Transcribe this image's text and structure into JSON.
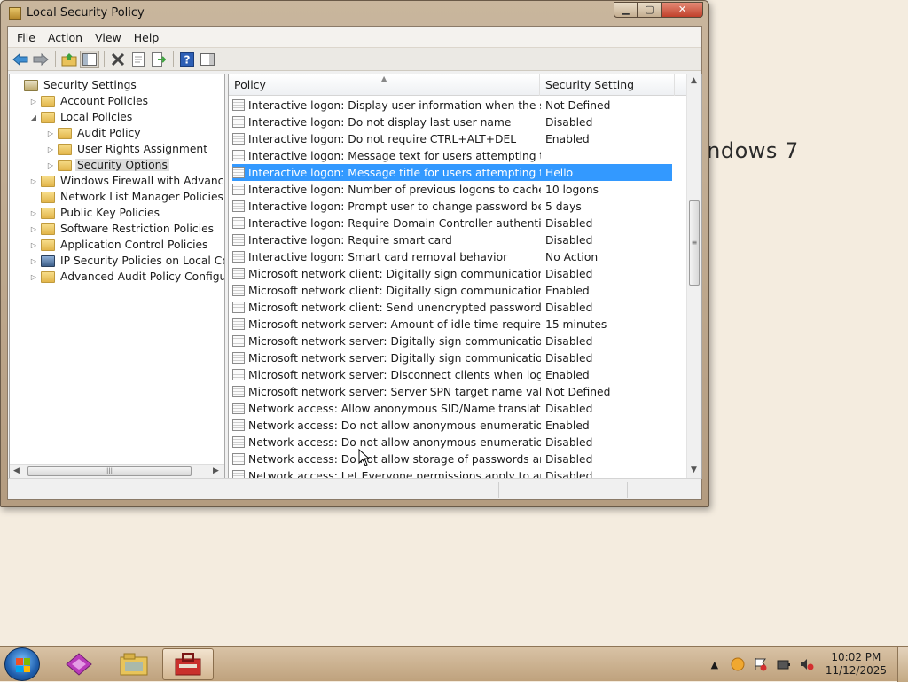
{
  "desktop": {
    "watermark": "indows 7"
  },
  "window": {
    "title": "Local Security Policy",
    "buttons": {
      "minimize": "▁",
      "maximize": "▢",
      "close": "✕"
    }
  },
  "menu": [
    "File",
    "Action",
    "View",
    "Help"
  ],
  "toolbar": {
    "icons": [
      "back-arrow-icon",
      "forward-arrow-icon",
      "up-folder-icon",
      "show-hide-tree-icon",
      "delete-icon",
      "properties-icon",
      "export-list-icon",
      "help-icon",
      "show-hide-action-pane-icon"
    ]
  },
  "tree": {
    "items": [
      {
        "label": "Security Settings",
        "level": 0,
        "arrow": "",
        "icon": "security-settings-icon"
      },
      {
        "label": "Account Policies",
        "level": 1,
        "arrow": "▷",
        "icon": "folder-icon"
      },
      {
        "label": "Local Policies",
        "level": 1,
        "arrow": "◢",
        "icon": "folder-icon"
      },
      {
        "label": "Audit Policy",
        "level": 2,
        "arrow": "▷",
        "icon": "folder-icon"
      },
      {
        "label": "User Rights Assignment",
        "level": 2,
        "arrow": "▷",
        "icon": "folder-icon"
      },
      {
        "label": "Security Options",
        "level": 2,
        "arrow": "▷",
        "icon": "folder-icon",
        "selected": true
      },
      {
        "label": "Windows Firewall with Advanced Secu",
        "level": 1,
        "arrow": "▷",
        "icon": "folder-icon"
      },
      {
        "label": "Network List Manager Policies",
        "level": 1,
        "arrow": "",
        "icon": "folder-icon"
      },
      {
        "label": "Public Key Policies",
        "level": 1,
        "arrow": "▷",
        "icon": "folder-icon"
      },
      {
        "label": "Software Restriction Policies",
        "level": 1,
        "arrow": "▷",
        "icon": "folder-icon"
      },
      {
        "label": "Application Control Policies",
        "level": 1,
        "arrow": "▷",
        "icon": "folder-icon"
      },
      {
        "label": "IP Security Policies on Local Compute",
        "level": 1,
        "arrow": "▷",
        "icon": "ip-security-icon"
      },
      {
        "label": "Advanced Audit Policy Configuration",
        "level": 1,
        "arrow": "▷",
        "icon": "folder-icon"
      }
    ]
  },
  "list": {
    "columns": {
      "policy": "Policy",
      "setting": "Security Setting"
    },
    "rows": [
      {
        "policy": "Interactive logon: Display user information when the session...",
        "setting": "Not Defined"
      },
      {
        "policy": "Interactive logon: Do not display last user name",
        "setting": "Disabled"
      },
      {
        "policy": "Interactive logon: Do not require CTRL+ALT+DEL",
        "setting": "Enabled"
      },
      {
        "policy": "Interactive logon: Message text for users attempting to log on",
        "setting": ""
      },
      {
        "policy": "Interactive logon: Message title for users attempting to log on",
        "setting": "Hello",
        "selected": true
      },
      {
        "policy": "Interactive logon: Number of previous logons to cache (in c...",
        "setting": "10 logons"
      },
      {
        "policy": "Interactive logon: Prompt user to change password before e...",
        "setting": "5 days"
      },
      {
        "policy": "Interactive logon: Require Domain Controller authentication...",
        "setting": "Disabled"
      },
      {
        "policy": "Interactive logon: Require smart card",
        "setting": "Disabled"
      },
      {
        "policy": "Interactive logon: Smart card removal behavior",
        "setting": "No Action"
      },
      {
        "policy": "Microsoft network client: Digitally sign communications (al...",
        "setting": "Disabled"
      },
      {
        "policy": "Microsoft network client: Digitally sign communications (if ...",
        "setting": "Enabled"
      },
      {
        "policy": "Microsoft network client: Send unencrypted password to thi...",
        "setting": "Disabled"
      },
      {
        "policy": "Microsoft network server: Amount of idle time required bef...",
        "setting": "15 minutes"
      },
      {
        "policy": "Microsoft network server: Digitally sign communications (al...",
        "setting": "Disabled"
      },
      {
        "policy": "Microsoft network server: Digitally sign communications (if ...",
        "setting": "Disabled"
      },
      {
        "policy": "Microsoft network server: Disconnect clients when logon ho...",
        "setting": "Enabled"
      },
      {
        "policy": "Microsoft network server: Server SPN target name validation...",
        "setting": "Not Defined"
      },
      {
        "policy": "Network access: Allow anonymous SID/Name translation",
        "setting": "Disabled"
      },
      {
        "policy": "Network access: Do not allow anonymous enumeration of S...",
        "setting": "Enabled"
      },
      {
        "policy": "Network access: Do not allow anonymous enumeration of S...",
        "setting": "Disabled"
      },
      {
        "policy": "Network access: Do not allow storage of passwords and cre...",
        "setting": "Disabled"
      },
      {
        "policy": "Network access: Let Everyone permissions apply to anonym...",
        "setting": "Disabled"
      }
    ]
  },
  "taskbar": {
    "apps": [
      "media-center-icon",
      "windows-explorer-icon",
      "local-security-policy-icon"
    ],
    "tray_icons": [
      "show-hidden-icons-chevron",
      "network-icon",
      "action-center-flag-icon",
      "power-icon",
      "volume-muted-icon"
    ],
    "clock": {
      "time": "10:02 PM",
      "date": "11/12/2025"
    }
  }
}
